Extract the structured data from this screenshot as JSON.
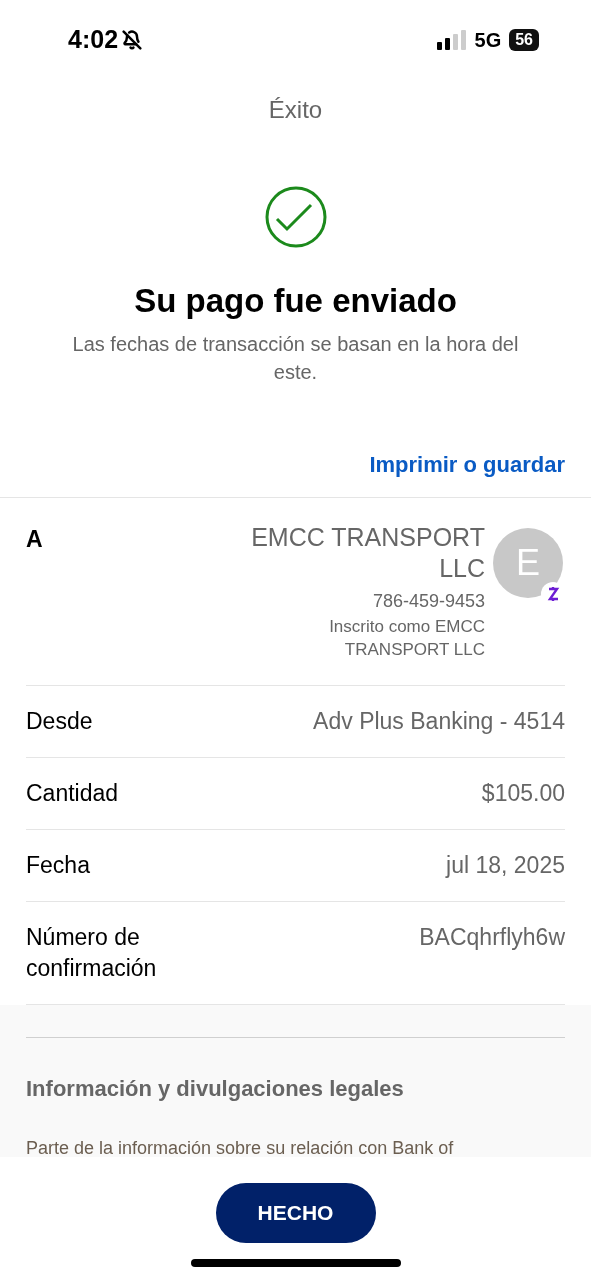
{
  "status_bar": {
    "time": "4:02",
    "silent": true,
    "network": "5G",
    "battery": "56"
  },
  "header": {
    "title": "Éxito"
  },
  "confirmation": {
    "heading": "Su pago fue enviado",
    "note": "Las fechas de transacción se basan en la hora del este."
  },
  "print_link": "Imprimir o guardar",
  "details": [
    {
      "kind": "recipient",
      "label": "A",
      "name": "EMCC TRANSPORT LLC",
      "phone": "786-459-9453",
      "enrolled": "Inscrito como EMCC TRANSPORT LLC",
      "initial": "E"
    },
    {
      "kind": "plain",
      "label": "Desde",
      "value": "Adv Plus Banking - 4514"
    },
    {
      "kind": "plain",
      "label": "Cantidad",
      "value": "$105.00"
    },
    {
      "kind": "plain",
      "label": "Fecha",
      "value": "jul 18, 2025"
    },
    {
      "kind": "plain",
      "label": "Número de confirmación",
      "value": "BACqhrflyh6w"
    }
  ],
  "legal": {
    "heading": "Información y divulgaciones legales",
    "text": "Parte de la información sobre su relación con Bank of"
  },
  "done_button": "HECHO"
}
